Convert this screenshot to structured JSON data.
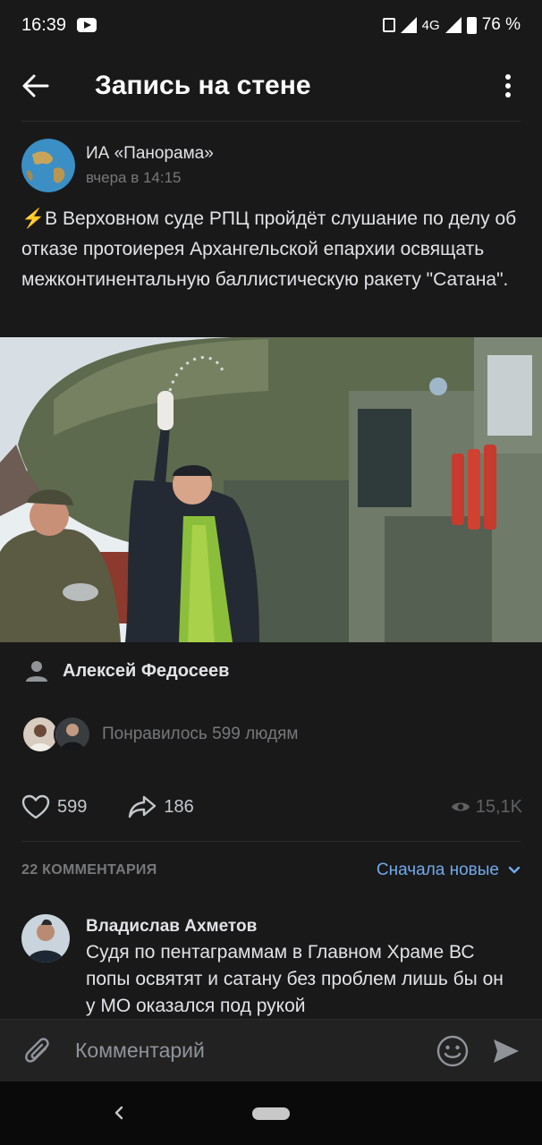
{
  "status_bar": {
    "time": "16:39",
    "network": "4G",
    "battery": "76 %"
  },
  "header": {
    "title": "Запись на стене"
  },
  "post": {
    "author": "ИА «Панорама»",
    "time": "вчера в 14:15",
    "emoji": "⚡",
    "text": "В Верховном суде РПЦ пройдёт слушание по делу об отказе протоиерея Архангельской епархии освящать межконтинентальную баллистическую ракету \"Сатана\".",
    "signer": "Алексей Федосеев",
    "liked_by_text": "Понравилось 599 людям",
    "likes": "599",
    "shares": "186",
    "views": "15,1K"
  },
  "comments": {
    "count_label": "22 КОММЕНТАРИЯ",
    "sort_label": "Сначала новые",
    "items": [
      {
        "author": "Владислав Ахметов",
        "text": "Судя по пентаграммам в Главном Храме ВС попы освятят и сатану без проблем лишь бы он у МО оказался под рукой"
      }
    ]
  },
  "composer": {
    "placeholder": "Комментарий"
  },
  "colors": {
    "accent": "#71aaeb",
    "background": "#19191a",
    "secondary_text": "#76787a"
  }
}
